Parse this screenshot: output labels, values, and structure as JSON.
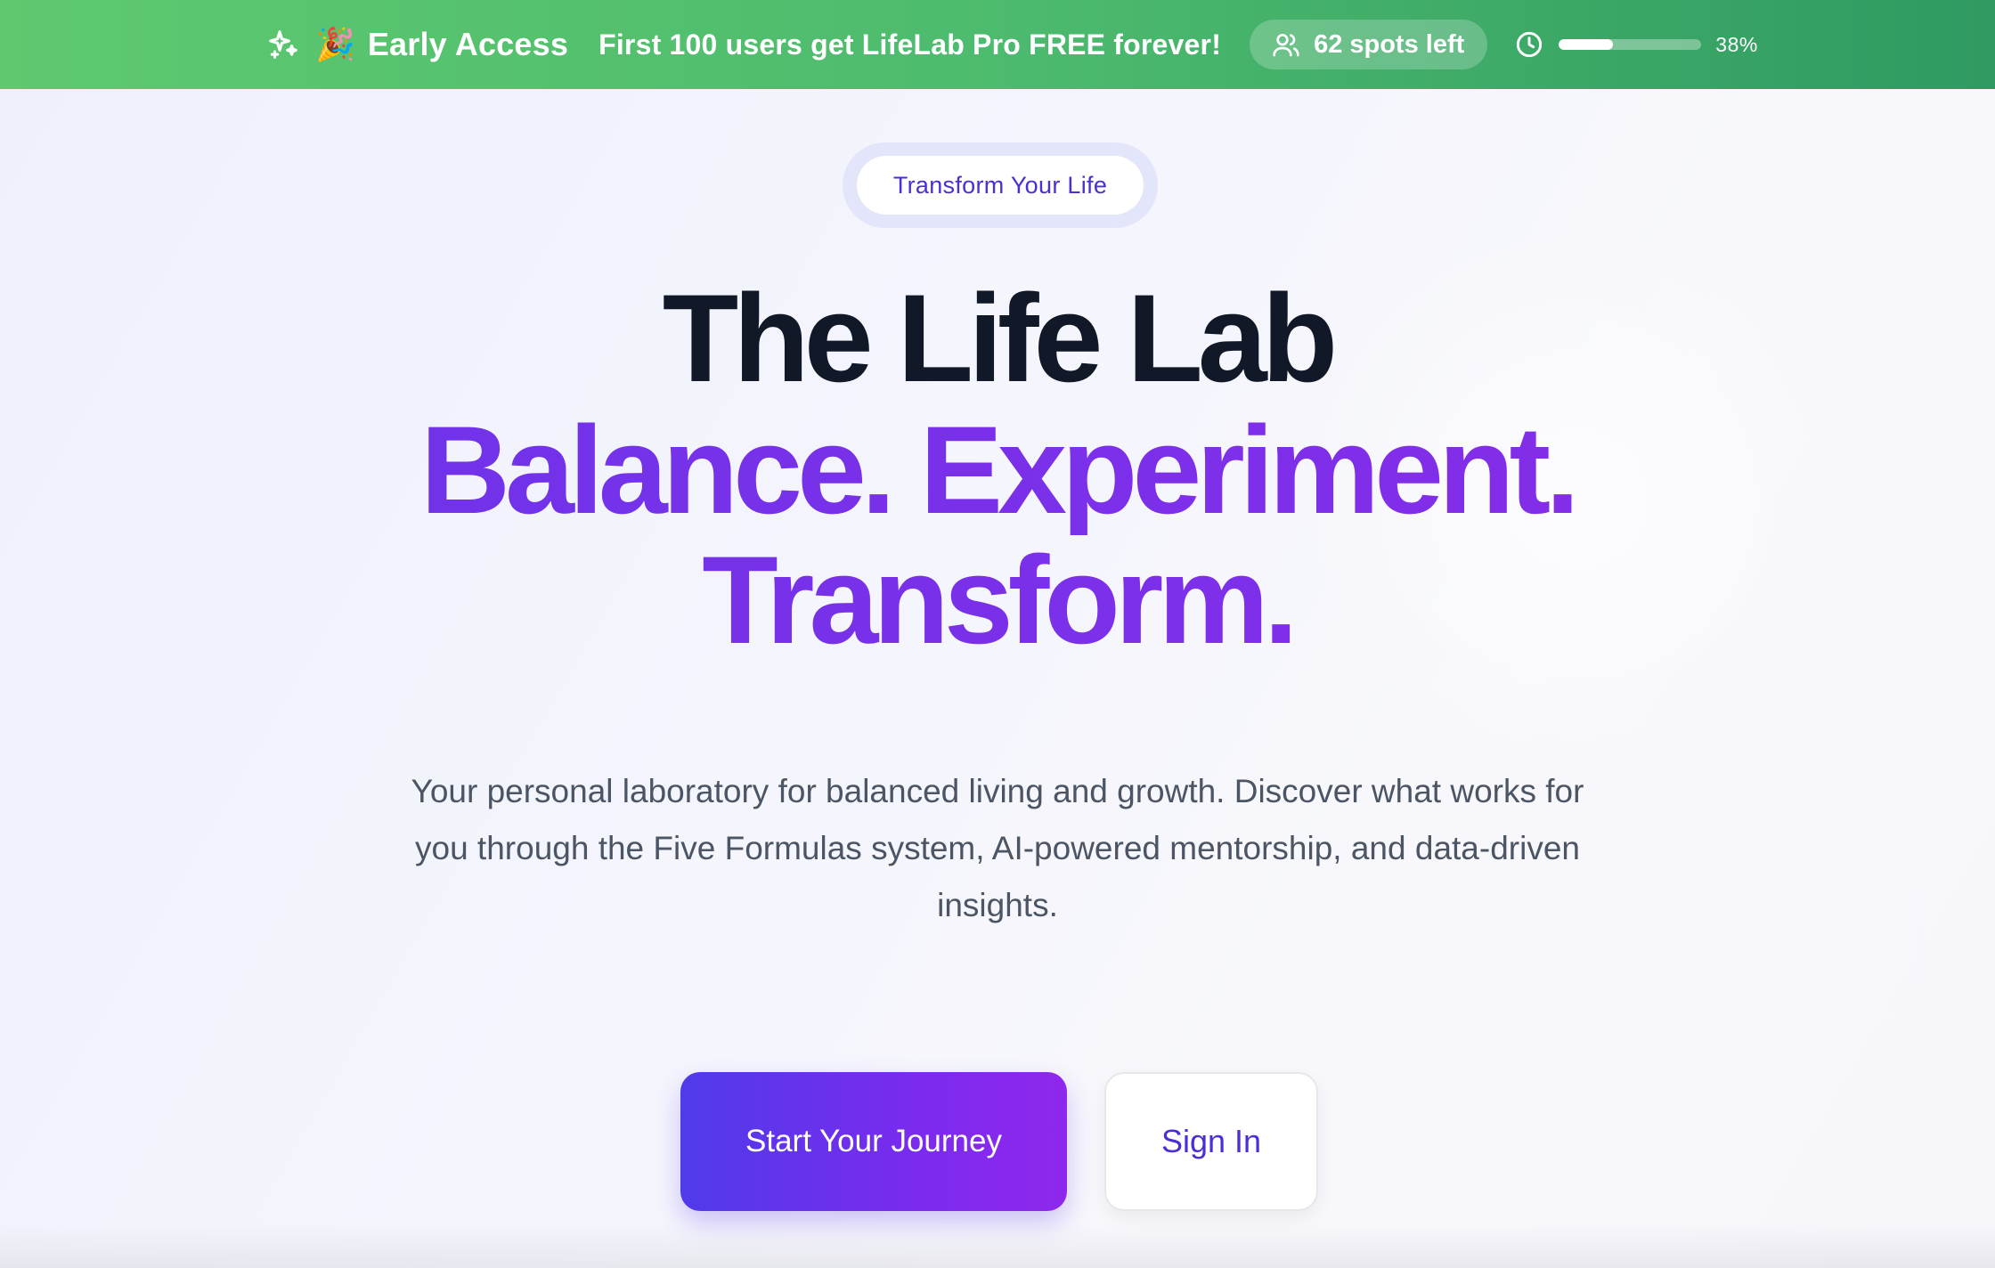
{
  "banner": {
    "early_access": "Early Access",
    "party_emoji": "🎉",
    "promo": "First 100 users get LifeLab Pro FREE forever!",
    "spots": "62 spots left",
    "progress_percent": 38,
    "progress_label": "38%",
    "icons": [
      "sparkle-icon",
      "party-icon",
      "users-icon",
      "clock-icon"
    ]
  },
  "hero": {
    "tag": "Transform Your Life",
    "title": "The Life Lab",
    "tagline_line1": "Balance. Experiment.",
    "tagline_line2": "Transform.",
    "description": "Your personal laboratory for balanced living and growth. Discover what works for you through the Five Formulas system, AI-powered mentorship, and data-driven insights.",
    "primary_cta": "Start Your Journey",
    "secondary_cta": "Sign In"
  },
  "colors": {
    "banner_start": "#5ec96f",
    "banner_end": "#2f9a61",
    "accent_purple": "#7a2ee8",
    "accent_indigo": "#4b2fd6",
    "title_dark": "#111827",
    "body_gray": "#4b5563"
  }
}
